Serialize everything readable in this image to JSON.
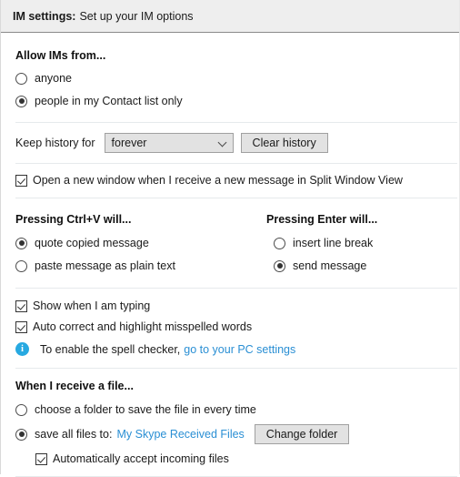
{
  "header": {
    "title_strong": "IM settings:",
    "title_rest": "Set up your IM options"
  },
  "allow_ims": {
    "title": "Allow IMs from...",
    "options": [
      {
        "label": "anyone",
        "selected": false
      },
      {
        "label": "people in my Contact list only",
        "selected": true
      }
    ]
  },
  "history": {
    "label": "Keep history for",
    "select_value": "forever",
    "select_icon": "chevron-down-icon",
    "clear_button": "Clear history"
  },
  "split_window": {
    "label": "Open a new window when I receive a new message in Split Window View",
    "checked": true
  },
  "ctrl_v": {
    "title": "Pressing Ctrl+V will...",
    "options": [
      {
        "label": "quote copied message",
        "selected": true
      },
      {
        "label": "paste message as plain text",
        "selected": false
      }
    ]
  },
  "enter_key": {
    "title": "Pressing Enter will...",
    "options": [
      {
        "label": "insert line break",
        "selected": false
      },
      {
        "label": "send message",
        "selected": true
      }
    ]
  },
  "typing": {
    "label": "Show when I am typing",
    "checked": true
  },
  "spellcheck": {
    "label": "Auto correct and highlight misspelled words",
    "checked": true,
    "info_icon": "info-circle-icon",
    "info_text": "To enable the spell checker,",
    "info_link": "go to your PC settings"
  },
  "receive_file": {
    "title": "When I receive a file...",
    "option_choose": {
      "label": "choose a folder to save the file in every time",
      "selected": false
    },
    "option_save": {
      "label": "save all files to:",
      "selected": true
    },
    "folder_link": "My Skype Received Files",
    "change_button": "Change folder",
    "auto_accept": {
      "label": "Automatically accept incoming files",
      "checked": true
    }
  },
  "colors": {
    "link": "#2a8fd4",
    "info_badge": "#27a9e1",
    "header_bg": "#eeeeee"
  }
}
